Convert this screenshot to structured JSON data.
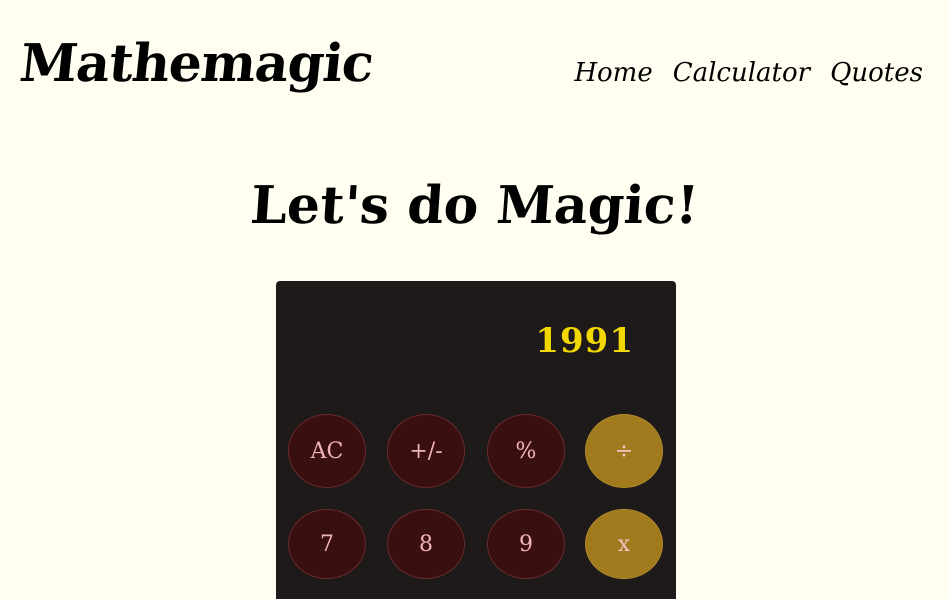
{
  "header": {
    "logo": "Mathemagic",
    "nav": [
      "Home",
      "Calculator",
      "Quotes"
    ]
  },
  "main": {
    "headline": "Let's do Magic!"
  },
  "calculator": {
    "display": "1991",
    "rows": [
      [
        "AC",
        "+/-",
        "%",
        "÷"
      ],
      [
        "7",
        "8",
        "9",
        "x"
      ]
    ]
  },
  "colors": {
    "background": "#fffef0",
    "calculator_body": "#1e1a1a",
    "display_text": "#f2d800",
    "button": "#3a0f10",
    "button_text": "#f0b4b4",
    "operator_button": "#a07a1c"
  }
}
